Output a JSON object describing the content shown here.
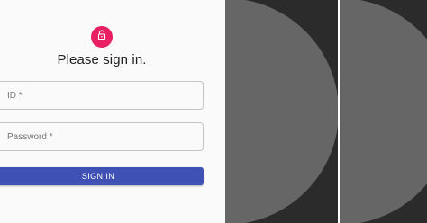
{
  "login": {
    "title": "Please sign in.",
    "lock_icon": "lock-icon",
    "id_placeholder": "ID *",
    "password_placeholder": "Password *",
    "signin_label": "SIGN IN"
  },
  "colors": {
    "avatar": "#e91e63",
    "button": "#3f51b5",
    "dark_background": "#2b2b2b",
    "disc": "#666666"
  }
}
